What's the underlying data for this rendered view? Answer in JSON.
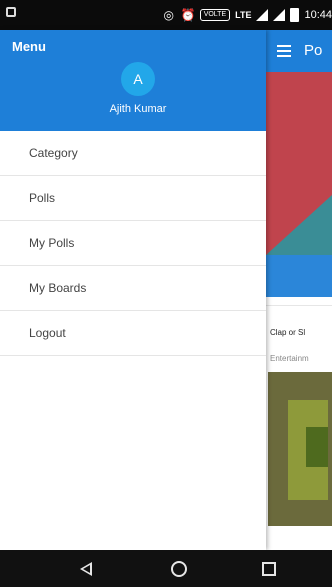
{
  "status_bar": {
    "lte": "LTE",
    "volte": "VOLTE",
    "time": "10:44"
  },
  "background_app": {
    "title": "Po",
    "card_title": "Clap or Sl",
    "card_subtitle": "Entertainm"
  },
  "drawer": {
    "header_label": "Menu",
    "avatar_letter": "A",
    "user_name": "Ajith Kumar",
    "items": [
      {
        "label": "Category"
      },
      {
        "label": "Polls"
      },
      {
        "label": "My Polls"
      },
      {
        "label": "My Boards"
      },
      {
        "label": "Logout"
      }
    ]
  },
  "colors": {
    "primary": "#1e7fd8",
    "avatar": "#22a7e9"
  }
}
